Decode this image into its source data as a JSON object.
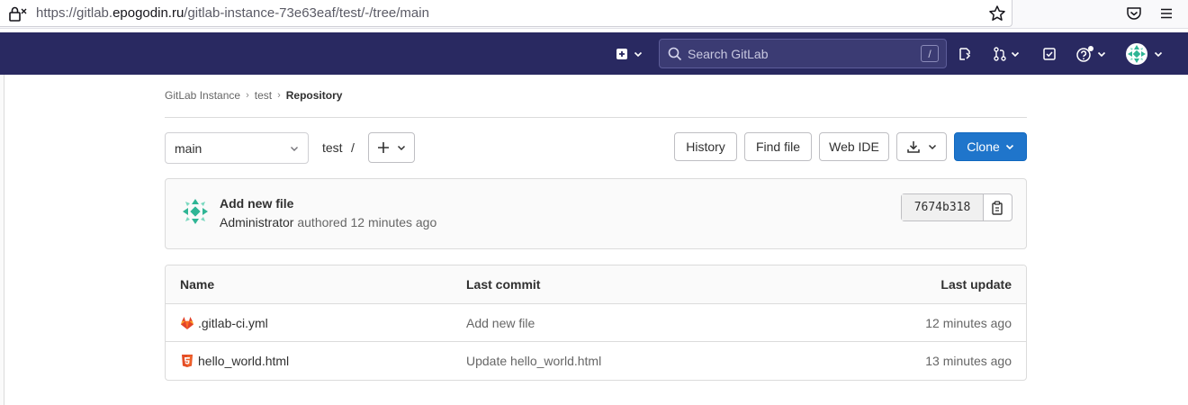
{
  "browser": {
    "url_prefix": "https://gitlab.",
    "url_host": "epogodin.ru",
    "url_path": "/gitlab-instance-73e63eaf/test/-/tree/main"
  },
  "header": {
    "search_placeholder": "Search GitLab",
    "search_shortcut": "/"
  },
  "breadcrumb": {
    "items": [
      "GitLab Instance",
      "test",
      "Repository"
    ]
  },
  "toolbar": {
    "branch": "main",
    "path_root": "test",
    "path_sep": "/",
    "history_label": "History",
    "find_file_label": "Find file",
    "web_ide_label": "Web IDE",
    "clone_label": "Clone"
  },
  "commit": {
    "title": "Add new file",
    "author": "Administrator",
    "authored_text": " authored 12 minutes ago",
    "sha": "7674b318"
  },
  "file_table": {
    "headers": {
      "name": "Name",
      "last_commit": "Last commit",
      "last_update": "Last update"
    },
    "rows": [
      {
        "name": ".gitlab-ci.yml",
        "icon": "gitlab-ci-icon",
        "last_commit": "Add new file",
        "last_update": "12 minutes ago"
      },
      {
        "name": "hello_world.html",
        "icon": "html5-icon",
        "last_commit": "Update hello_world.html",
        "last_update": "13 minutes ago"
      }
    ]
  },
  "colors": {
    "header_bg": "#292961",
    "clone_bg": "#1f75cb",
    "gitlab_orange": "#e24329",
    "html_orange": "#e44d26",
    "avatar_teal": "#2fb595"
  }
}
